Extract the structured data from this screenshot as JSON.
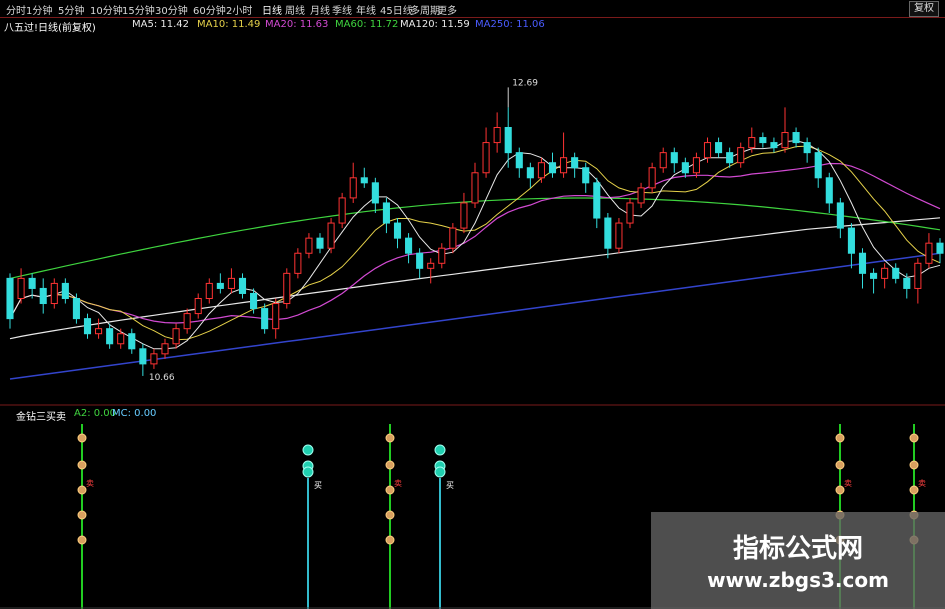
{
  "toolbar": {
    "tabs": [
      "分时",
      "1分钟",
      "5分钟",
      "10分钟",
      "15分钟",
      "30分钟",
      "60分钟",
      "2小时",
      "日线",
      "周线",
      "月线",
      "季线",
      "年线",
      "45日线",
      "多周期",
      "更多"
    ],
    "restore_label": "复权"
  },
  "ma_legend": {
    "indicator": "八五过!日线(前复权)",
    "items": [
      {
        "label": "MA5: 11.42",
        "color": "#e8e8e8"
      },
      {
        "label": "MA10: 11.49",
        "color": "#e6d24a"
      },
      {
        "label": "MA20: 11.63",
        "color": "#d24ad2"
      },
      {
        "label": "MA60: 11.72",
        "color": "#3fd43f"
      },
      {
        "label": "MA120: 11.59",
        "color": "#e8e8e8"
      },
      {
        "label": "MA250: 11.06",
        "color": "#4a5cff"
      }
    ]
  },
  "sub_legend": {
    "name": "金钻三买卖",
    "items": [
      {
        "label": "A2: 0.00",
        "color": "#3fd43f"
      },
      {
        "label": "MC: 0.00",
        "color": "#66ccff"
      }
    ]
  },
  "chart_data": [
    {
      "type": "candlestick",
      "title": "",
      "ylim": [
        9.9,
        13.3
      ],
      "colors": {
        "up": "#ff3333",
        "down": "#33dddd",
        "ma5": "#e8e8e8",
        "ma10": "#e6d24a",
        "ma20": "#d24ad2",
        "ma60": "#3fd43f",
        "ma120": "#e8e8e8",
        "ma250": "#3344cc"
      },
      "candles": [
        [
          10.95,
          10.55,
          11.0,
          10.45
        ],
        [
          10.75,
          10.95,
          11.05,
          10.7
        ],
        [
          10.95,
          10.85,
          11.0,
          10.75
        ],
        [
          10.85,
          10.7,
          10.95,
          10.6
        ],
        [
          10.7,
          10.9,
          10.95,
          10.65
        ],
        [
          10.9,
          10.75,
          10.95,
          10.7
        ],
        [
          10.75,
          10.55,
          10.8,
          10.5
        ],
        [
          10.55,
          10.4,
          10.6,
          10.35
        ],
        [
          10.4,
          10.45,
          10.55,
          10.35
        ],
        [
          10.45,
          10.3,
          10.5,
          10.25
        ],
        [
          10.3,
          10.4,
          10.45,
          10.25
        ],
        [
          10.4,
          10.25,
          10.45,
          10.2
        ],
        [
          10.25,
          10.1,
          10.3,
          9.98
        ],
        [
          10.1,
          10.2,
          10.25,
          10.05
        ],
        [
          10.2,
          10.3,
          10.35,
          10.15
        ],
        [
          10.3,
          10.45,
          10.5,
          10.25
        ],
        [
          10.45,
          10.6,
          10.65,
          10.4
        ],
        [
          10.6,
          10.75,
          10.8,
          10.55
        ],
        [
          10.75,
          10.9,
          10.95,
          10.7
        ],
        [
          10.9,
          10.85,
          11.0,
          10.8
        ],
        [
          10.85,
          10.95,
          11.05,
          10.8
        ],
        [
          10.95,
          10.8,
          11.0,
          10.75
        ],
        [
          10.8,
          10.65,
          10.85,
          10.6
        ],
        [
          10.65,
          10.45,
          10.7,
          10.4
        ],
        [
          10.45,
          10.7,
          10.75,
          10.35
        ],
        [
          10.7,
          11.0,
          11.05,
          10.65
        ],
        [
          11.0,
          11.2,
          11.25,
          10.95
        ],
        [
          11.2,
          11.35,
          11.4,
          11.15
        ],
        [
          11.35,
          11.25,
          11.4,
          11.2
        ],
        [
          11.25,
          11.5,
          11.55,
          11.2
        ],
        [
          11.5,
          11.75,
          11.8,
          11.45
        ],
        [
          11.75,
          11.95,
          12.1,
          11.7
        ],
        [
          11.95,
          11.9,
          12.05,
          11.85
        ],
        [
          11.9,
          11.7,
          11.95,
          11.6
        ],
        [
          11.7,
          11.5,
          11.75,
          11.4
        ],
        [
          11.5,
          11.35,
          11.55,
          11.25
        ],
        [
          11.35,
          11.2,
          11.4,
          11.1
        ],
        [
          11.2,
          11.05,
          11.25,
          10.95
        ],
        [
          11.05,
          11.1,
          11.15,
          10.9
        ],
        [
          11.1,
          11.25,
          11.3,
          11.05
        ],
        [
          11.25,
          11.45,
          11.5,
          11.2
        ],
        [
          11.45,
          11.7,
          11.8,
          11.4
        ],
        [
          11.7,
          12.0,
          12.1,
          11.65
        ],
        [
          12.0,
          12.3,
          12.45,
          11.95
        ],
        [
          12.3,
          12.45,
          12.6,
          12.2
        ],
        [
          12.45,
          12.2,
          12.65,
          12.05
        ],
        [
          12.2,
          12.05,
          12.25,
          11.95
        ],
        [
          12.05,
          11.95,
          12.1,
          11.85
        ],
        [
          11.95,
          12.1,
          12.15,
          11.9
        ],
        [
          12.1,
          12.0,
          12.2,
          11.95
        ],
        [
          12.0,
          12.15,
          12.4,
          11.95
        ],
        [
          12.15,
          12.05,
          12.2,
          11.95
        ],
        [
          12.05,
          11.9,
          12.1,
          11.8
        ],
        [
          11.9,
          11.55,
          11.95,
          11.45
        ],
        [
          11.55,
          11.25,
          11.6,
          11.15
        ],
        [
          11.25,
          11.5,
          11.55,
          11.2
        ],
        [
          11.5,
          11.7,
          11.75,
          11.45
        ],
        [
          11.7,
          11.85,
          11.9,
          11.65
        ],
        [
          11.85,
          12.05,
          12.1,
          11.8
        ],
        [
          12.05,
          12.2,
          12.25,
          12.0
        ],
        [
          12.2,
          12.1,
          12.25,
          12.0
        ],
        [
          12.1,
          12.0,
          12.15,
          11.95
        ],
        [
          12.0,
          12.15,
          12.2,
          11.95
        ],
        [
          12.15,
          12.3,
          12.35,
          12.1
        ],
        [
          12.3,
          12.2,
          12.35,
          12.15
        ],
        [
          12.2,
          12.1,
          12.25,
          12.05
        ],
        [
          12.1,
          12.25,
          12.3,
          12.05
        ],
        [
          12.25,
          12.35,
          12.45,
          12.2
        ],
        [
          12.35,
          12.3,
          12.4,
          12.25
        ],
        [
          12.3,
          12.25,
          12.35,
          12.2
        ],
        [
          12.25,
          12.4,
          12.65,
          12.2
        ],
        [
          12.4,
          12.3,
          12.45,
          12.25
        ],
        [
          12.3,
          12.2,
          12.35,
          12.1
        ],
        [
          12.2,
          11.95,
          12.25,
          11.85
        ],
        [
          11.95,
          11.7,
          12.0,
          11.6
        ],
        [
          11.7,
          11.45,
          11.75,
          11.35
        ],
        [
          11.45,
          11.2,
          11.5,
          11.05
        ],
        [
          11.2,
          11.0,
          11.25,
          10.85
        ],
        [
          11.0,
          10.95,
          11.05,
          10.8
        ],
        [
          10.95,
          11.05,
          11.1,
          10.85
        ],
        [
          11.05,
          10.95,
          11.1,
          10.9
        ],
        [
          10.95,
          10.85,
          11.0,
          10.75
        ],
        [
          10.85,
          11.1,
          11.15,
          10.7
        ],
        [
          11.1,
          11.3,
          11.4,
          11.05
        ],
        [
          11.3,
          11.2,
          11.35,
          11.1
        ]
      ],
      "annotations": [
        {
          "label": "10.66"
        },
        {
          "label": "12.69"
        }
      ]
    },
    {
      "type": "signal",
      "markers": [
        "卖",
        "卖",
        "卖",
        "卖",
        "卖",
        "买",
        "买"
      ]
    }
  ],
  "watermark": {
    "title": "指标公式网",
    "url": "www.zbgs3.com"
  }
}
